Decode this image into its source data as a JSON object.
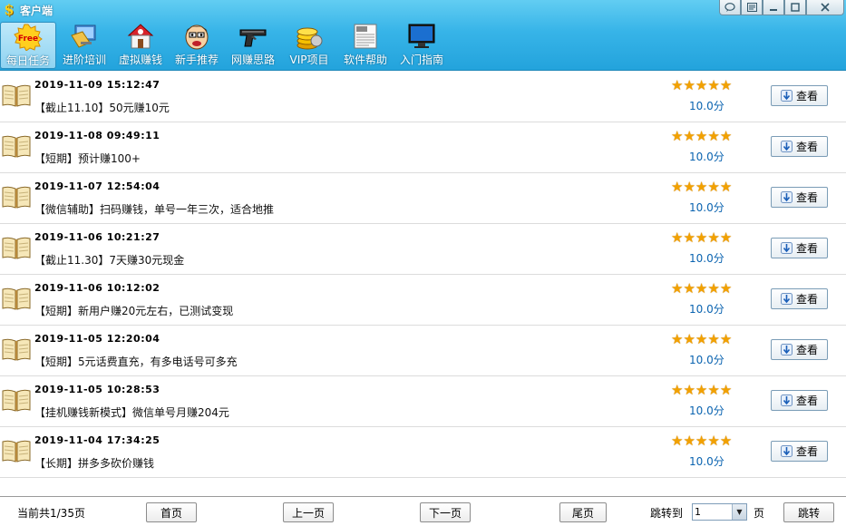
{
  "window": {
    "title": "客户端",
    "controls": [
      "speech-bubble-icon",
      "menu-icon",
      "minimize-icon",
      "maximize-icon",
      "close-icon"
    ]
  },
  "toolbar": {
    "items": [
      {
        "label": "每日任务",
        "icon": "free-badge-icon",
        "active": true
      },
      {
        "label": "进阶培训",
        "icon": "monitor-book-icon",
        "active": false
      },
      {
        "label": "虚拟赚钱",
        "icon": "house-icon",
        "active": false
      },
      {
        "label": "新手推荐",
        "icon": "face-icon",
        "active": false
      },
      {
        "label": "网赚思路",
        "icon": "pistol-icon",
        "active": false
      },
      {
        "label": "VIP项目",
        "icon": "coins-icon",
        "active": false
      },
      {
        "label": "软件帮助",
        "icon": "newspaper-icon",
        "active": false
      },
      {
        "label": "入门指南",
        "icon": "monitor-icon",
        "active": false
      }
    ]
  },
  "tasks": [
    {
      "time": "2019-11-09 15:12:47",
      "title": "【截止11.10】50元赚10元",
      "score": "10.0分",
      "stars": 5,
      "button": "查看"
    },
    {
      "time": "2019-11-08 09:49:11",
      "title": "【短期】预计赚100+",
      "score": "10.0分",
      "stars": 5,
      "button": "查看"
    },
    {
      "time": "2019-11-07 12:54:04",
      "title": "【微信辅助】扫码赚钱，单号一年三次，适合地推",
      "score": "10.0分",
      "stars": 5,
      "button": "查看"
    },
    {
      "time": "2019-11-06 10:21:27",
      "title": "【截止11.30】7天赚30元现金",
      "score": "10.0分",
      "stars": 5,
      "button": "查看"
    },
    {
      "time": "2019-11-06 10:12:02",
      "title": "【短期】新用户赚20元左右，已测试变现",
      "score": "10.0分",
      "stars": 5,
      "button": "查看"
    },
    {
      "time": "2019-11-05 12:20:04",
      "title": "【短期】5元话费直充，有多电话号可多充",
      "score": "10.0分",
      "stars": 5,
      "button": "查看"
    },
    {
      "time": "2019-11-05 10:28:53",
      "title": "【挂机赚钱新模式】微信单号月赚204元",
      "score": "10.0分",
      "stars": 5,
      "button": "查看"
    },
    {
      "time": "2019-11-04 17:34:25",
      "title": "【长期】拼多多砍价赚钱",
      "score": "10.0分",
      "stars": 5,
      "button": "查看"
    }
  ],
  "pagination": {
    "info": "当前共1/35页",
    "first": "首页",
    "prev": "上一页",
    "next": "下一页",
    "last": "尾页",
    "jump_label": "跳转到",
    "page_value": "1",
    "page_unit": "页",
    "jump_button": "跳转"
  },
  "colors": {
    "toolbar_top": "#62cdf2",
    "toolbar_bottom": "#23a3dc",
    "star": "#f2a100",
    "score": "#0a63b0"
  }
}
